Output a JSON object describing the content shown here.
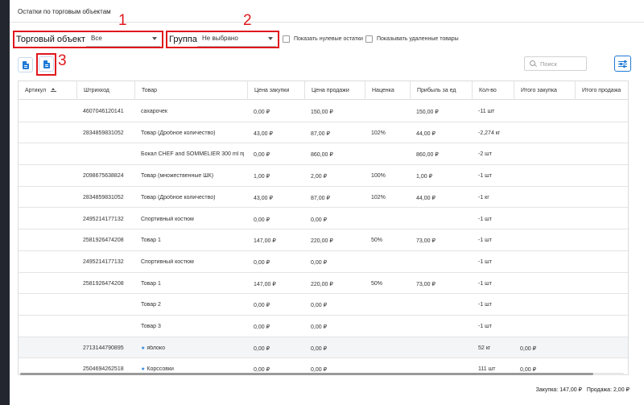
{
  "page_title": "Остатки по торговым объектам",
  "filters": {
    "store": {
      "label": "Торговый объект",
      "value": "Все"
    },
    "group": {
      "label": "Группа",
      "value": "Не выбрано"
    },
    "show_zero": "Показать нулевые остатки",
    "show_deleted": "Показывать удаленные товары"
  },
  "annotations": [
    "1",
    "2",
    "3"
  ],
  "search_placeholder": "Поиск",
  "columns": [
    "Артикул",
    "Штрихкод",
    "Товар",
    "Цена закупки",
    "Цена продажи",
    "Наценка",
    "Прибыль за ед",
    "Кол-во",
    "Итого закупка",
    "Итого продажа"
  ],
  "rows": [
    {
      "article": "",
      "barcode": "4607046120141",
      "product": "сахарочек",
      "buy": "0,00 ₽",
      "sell": "150,00 ₽",
      "markup": "",
      "profit": "150,00 ₽",
      "qty": "-11 шт",
      "total_buy": "",
      "total_sell": "",
      "starred": false
    },
    {
      "article": "",
      "barcode": "2834859831052",
      "product": "Товар (Дробное количество)",
      "buy": "43,00 ₽",
      "sell": "87,00 ₽",
      "markup": "102%",
      "profit": "44,00 ₽",
      "qty": "-2,274 кг",
      "total_buy": "",
      "total_sell": "",
      "starred": false
    },
    {
      "article": "",
      "barcode": "",
      "product": "Бокал CHEF and SOMMELIER 300 ml пр...",
      "buy": "0,00 ₽",
      "sell": "860,00 ₽",
      "markup": "",
      "profit": "860,00 ₽",
      "qty": "-2 шт",
      "total_buy": "",
      "total_sell": "",
      "starred": false
    },
    {
      "article": "",
      "barcode": "2098675638824",
      "product": "Товар (множественные ШК)",
      "buy": "1,00 ₽",
      "sell": "2,00 ₽",
      "markup": "100%",
      "profit": "1,00 ₽",
      "qty": "-1 шт",
      "total_buy": "",
      "total_sell": "",
      "starred": false
    },
    {
      "article": "",
      "barcode": "2834859831052",
      "product": "Товар (Дробное количество)",
      "buy": "43,00 ₽",
      "sell": "87,00 ₽",
      "markup": "102%",
      "profit": "44,00 ₽",
      "qty": "-1 кг",
      "total_buy": "",
      "total_sell": "",
      "starred": false
    },
    {
      "article": "",
      "barcode": "2495214177132",
      "product": "Спортивный костюм",
      "buy": "0,00 ₽",
      "sell": "0,00 ₽",
      "markup": "",
      "profit": "",
      "qty": "-1 шт",
      "total_buy": "",
      "total_sell": "",
      "starred": false
    },
    {
      "article": "",
      "barcode": "2581926474208",
      "product": "Товар 1",
      "buy": "147,00 ₽",
      "sell": "220,00 ₽",
      "markup": "50%",
      "profit": "73,00 ₽",
      "qty": "-1 шт",
      "total_buy": "",
      "total_sell": "",
      "starred": false
    },
    {
      "article": "",
      "barcode": "2495214177132",
      "product": "Спортивный костюм",
      "buy": "0,00 ₽",
      "sell": "0,00 ₽",
      "markup": "",
      "profit": "",
      "qty": "-1 шт",
      "total_buy": "",
      "total_sell": "",
      "starred": false
    },
    {
      "article": "",
      "barcode": "2581926474208",
      "product": "Товар 1",
      "buy": "147,00 ₽",
      "sell": "220,00 ₽",
      "markup": "50%",
      "profit": "73,00 ₽",
      "qty": "-1 шт",
      "total_buy": "",
      "total_sell": "",
      "starred": false
    },
    {
      "article": "",
      "barcode": "",
      "product": "Товар 2",
      "buy": "0,00 ₽",
      "sell": "0,00 ₽",
      "markup": "",
      "profit": "",
      "qty": "-1 шт",
      "total_buy": "",
      "total_sell": "",
      "starred": false
    },
    {
      "article": "",
      "barcode": "",
      "product": "Товар 3",
      "buy": "0,00 ₽",
      "sell": "0,00 ₽",
      "markup": "",
      "profit": "",
      "qty": "-1 шт",
      "total_buy": "",
      "total_sell": "",
      "starred": false
    },
    {
      "article": "",
      "barcode": "2713144790895",
      "product": "яблоко",
      "buy": "0,00 ₽",
      "sell": "0,00 ₽",
      "markup": "",
      "profit": "",
      "qty": "52 кг",
      "total_buy": "0,00 ₽",
      "total_sell": "",
      "starred": true
    },
    {
      "article": "",
      "barcode": "2504694262518",
      "product": "Корссовки",
      "buy": "0,00 ₽",
      "sell": "0,00 ₽",
      "markup": "",
      "profit": "",
      "qty": "111 шт",
      "total_buy": "0,00 ₽",
      "total_sell": "",
      "starred": true
    }
  ],
  "footer": {
    "purchase": "Закупка: 147,00 ₽",
    "sale": "Продажа: 2,00 ₽"
  },
  "colors": {
    "accent": "#1f7ad6",
    "highlight": "#e0161c"
  }
}
